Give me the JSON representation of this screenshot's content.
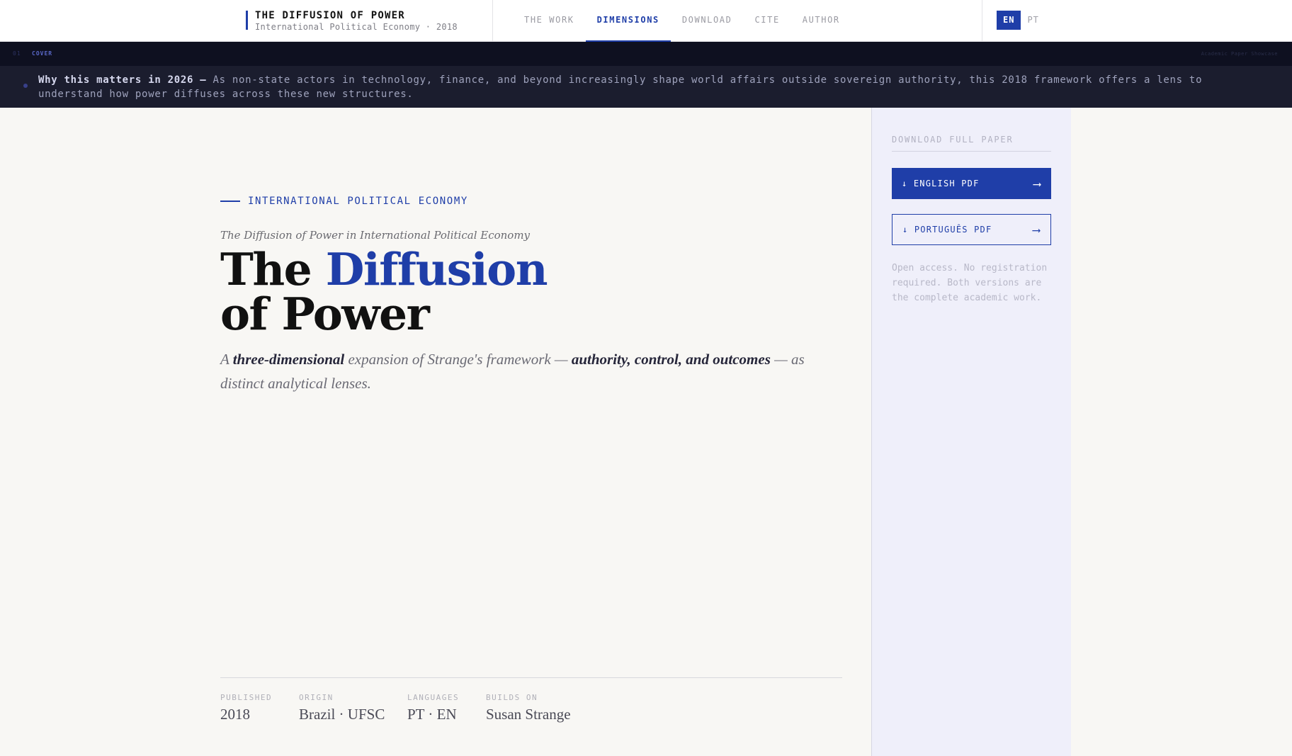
{
  "header": {
    "brand_title": "THE DIFFUSION OF POWER",
    "brand_subtitle": "International Political Economy · 2018",
    "nav": [
      {
        "label": "THE WORK"
      },
      {
        "label": "DIMENSIONS"
      },
      {
        "label": "DOWNLOAD"
      },
      {
        "label": "CITE"
      },
      {
        "label": "AUTHOR"
      }
    ],
    "active_nav": "DIMENSIONS",
    "languages": [
      "EN",
      "PT"
    ],
    "active_language": "EN"
  },
  "strip": {
    "number": "01",
    "label": "COVER",
    "right": "Academic Paper Showcase"
  },
  "why": {
    "lead": "Why this matters in 2026 —",
    "text": "As non-state actors in technology, finance, and beyond increasingly shape world affairs outside sovereign authority, this 2018 framework offers a lens to understand how power diffuses across these new structures."
  },
  "hero": {
    "eyebrow": "INTERNATIONAL POLITICAL ECONOMY",
    "subtitle": "The Diffusion of Power in International Political Economy",
    "title_part1": "The ",
    "title_accent": "Diffusion",
    "title_line2": "of Power",
    "lede": {
      "p1": "A ",
      "b1": "three-dimensional",
      "p2": " expansion of Strange's framework — ",
      "b2": "authority, control, and outcomes",
      "p3": " — as distinct analytical lenses."
    }
  },
  "meta": [
    {
      "label": "PUBLISHED",
      "value": "2018"
    },
    {
      "label": "ORIGIN",
      "value": "Brazil · UFSC"
    },
    {
      "label": "LANGUAGES",
      "value": "PT · EN"
    },
    {
      "label": "BUILDS ON",
      "value": "Susan Strange"
    }
  ],
  "panel": {
    "heading": "DOWNLOAD FULL PAPER",
    "english_button": "↓ ENGLISH PDF",
    "portuguese_button": "↓ PORTUGUÊS PDF",
    "arrow": "⟶",
    "note": "Open access. No registration required. Both versions are the complete academic work."
  },
  "colors": {
    "accent": "#1f3ea8",
    "banner": "#1b1d2e",
    "panel_bg": "#efeffa"
  }
}
